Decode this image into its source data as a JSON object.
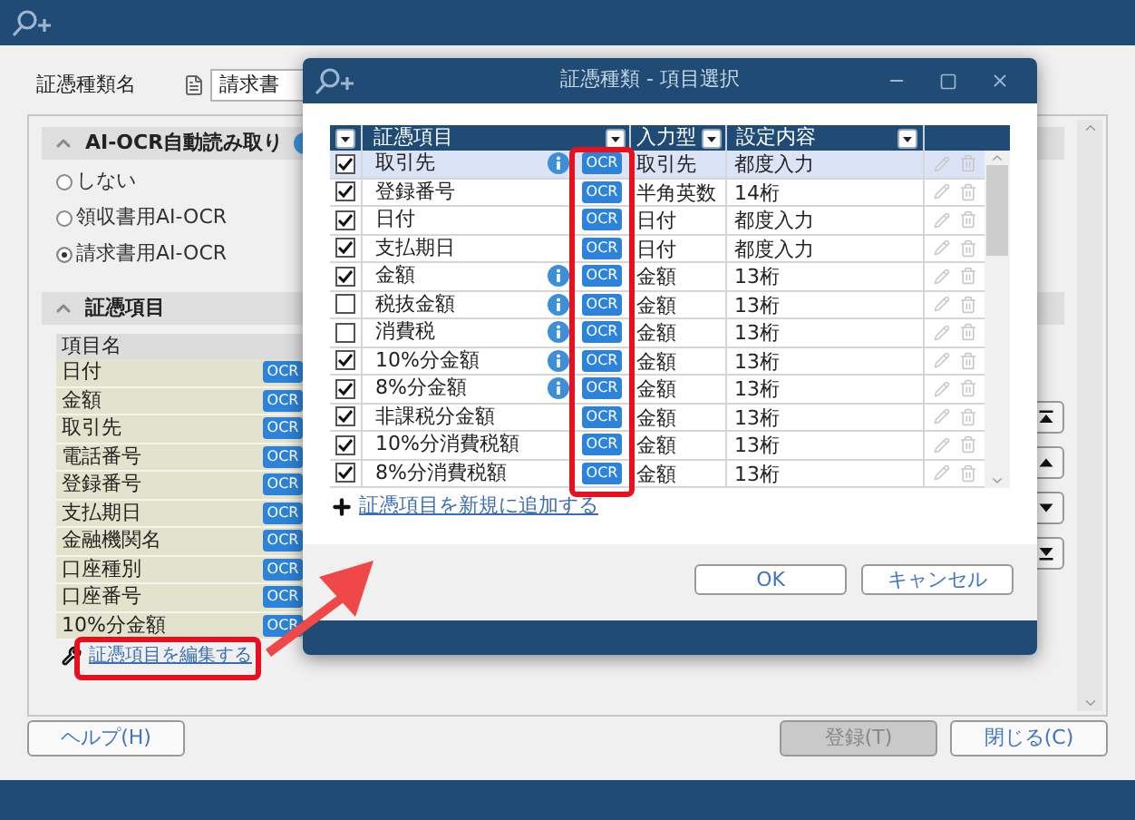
{
  "main_window": {
    "doc_type_label": "証憑種類名",
    "doc_type_value": "請求書",
    "ocr_section": {
      "title": "AI-OCR自動読み取り",
      "expanded": true,
      "options": [
        {
          "label": "しない",
          "selected": false
        },
        {
          "label": "領収書用AI-OCR",
          "selected": false
        },
        {
          "label": "請求書用AI-OCR",
          "selected": true
        }
      ]
    },
    "items_section": {
      "title": "証憑項目",
      "expanded": true,
      "column": "項目名",
      "rows": [
        {
          "name": "日付",
          "badge": "OCR"
        },
        {
          "name": "金額",
          "badge": "OCR"
        },
        {
          "name": "取引先",
          "badge": "OCR"
        },
        {
          "name": "電話番号",
          "badge": "OCR"
        },
        {
          "name": "登録番号",
          "badge": "OCR"
        },
        {
          "name": "支払期日",
          "badge": "OCR"
        },
        {
          "name": "金融機関名",
          "badge": "OCR"
        },
        {
          "name": "口座種別",
          "badge": "OCR"
        },
        {
          "name": "口座番号",
          "badge": "OCR"
        },
        {
          "name": "10%分金額",
          "badge": "OCR"
        }
      ],
      "edit_link": "証憑項目を編集する"
    },
    "buttons": [
      {
        "label": "ヘルプ(H)",
        "disabled": false
      },
      {
        "label": "登録(T)",
        "disabled": true
      },
      {
        "label": "閉じる(C)",
        "disabled": false
      }
    ]
  },
  "dialog": {
    "title": "証憑種類 - 項目選択",
    "columns": [
      "証憑項目",
      "入力型",
      "設定内容"
    ],
    "rows": [
      {
        "checked": true,
        "selected": true,
        "name": "取引先",
        "info": true,
        "badge": "OCR",
        "input_type": "取引先",
        "setting": "都度入力"
      },
      {
        "checked": true,
        "selected": false,
        "name": "登録番号",
        "info": false,
        "badge": "OCR",
        "input_type": "半角英数",
        "setting": "14桁"
      },
      {
        "checked": true,
        "selected": false,
        "name": "日付",
        "info": false,
        "badge": "OCR",
        "input_type": "日付",
        "setting": "都度入力"
      },
      {
        "checked": true,
        "selected": false,
        "name": "支払期日",
        "info": false,
        "badge": "OCR",
        "input_type": "日付",
        "setting": "都度入力"
      },
      {
        "checked": true,
        "selected": false,
        "name": "金額",
        "info": true,
        "badge": "OCR",
        "input_type": "金額",
        "setting": "13桁"
      },
      {
        "checked": false,
        "selected": false,
        "name": "税抜金額",
        "info": true,
        "badge": "OCR",
        "input_type": "金額",
        "setting": "13桁"
      },
      {
        "checked": false,
        "selected": false,
        "name": "消費税",
        "info": true,
        "badge": "OCR",
        "input_type": "金額",
        "setting": "13桁"
      },
      {
        "checked": true,
        "selected": false,
        "name": "10%分金額",
        "info": true,
        "badge": "OCR",
        "input_type": "金額",
        "setting": "13桁"
      },
      {
        "checked": true,
        "selected": false,
        "name": "8%分金額",
        "info": true,
        "badge": "OCR",
        "input_type": "金額",
        "setting": "13桁"
      },
      {
        "checked": true,
        "selected": false,
        "name": "非課税分金額",
        "info": false,
        "badge": "OCR",
        "input_type": "金額",
        "setting": "13桁"
      },
      {
        "checked": true,
        "selected": false,
        "name": "10%分消費税額",
        "info": false,
        "badge": "OCR",
        "input_type": "金額",
        "setting": "13桁"
      },
      {
        "checked": true,
        "selected": false,
        "name": "8%分消費税額",
        "info": false,
        "badge": "OCR",
        "input_type": "金額",
        "setting": "13桁"
      }
    ],
    "add_link": "証憑項目を新規に追加する",
    "buttons": [
      "OK",
      "キャンセル"
    ]
  }
}
